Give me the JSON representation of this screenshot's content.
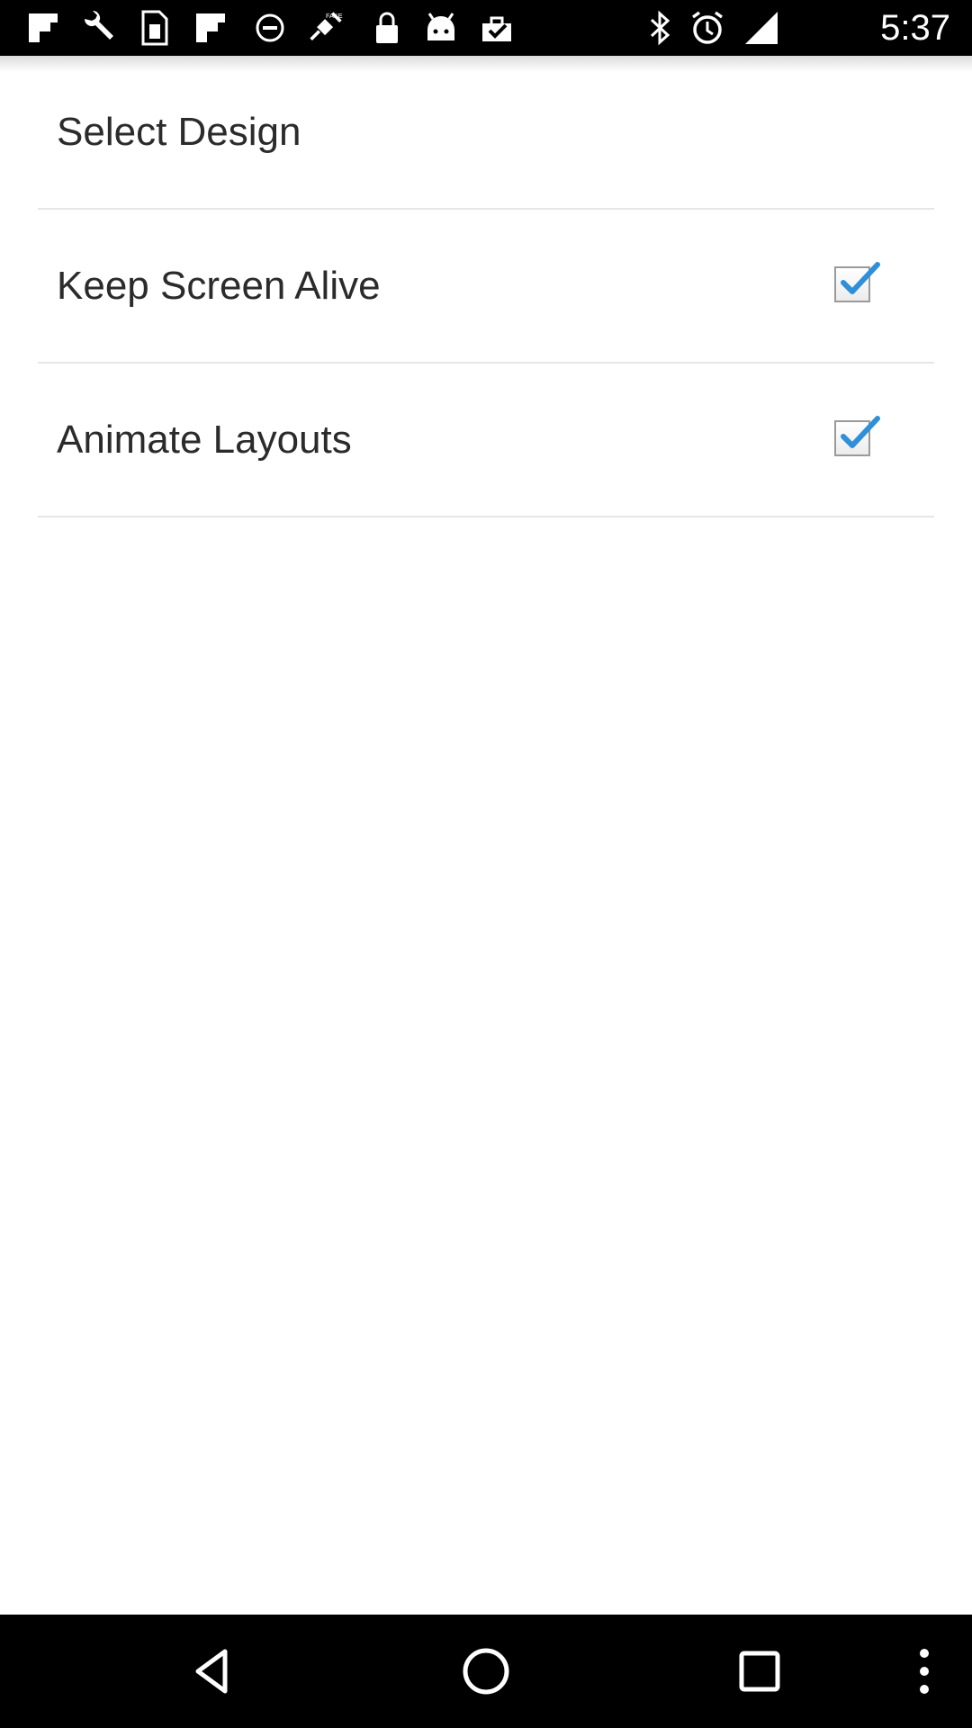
{
  "status_bar": {
    "time": "5:37",
    "left_icons": [
      "flipboard-icon",
      "wrench-icon",
      "sim-card-icon",
      "flipboard-icon",
      "blocked-icon",
      "fake-gps-icon",
      "lock-icon",
      "android-icon",
      "check-bag-icon"
    ],
    "right_icons": [
      "bluetooth-icon",
      "alarm-icon",
      "signal-icon"
    ]
  },
  "settings": {
    "items": [
      {
        "label": "Select Design",
        "has_checkbox": false
      },
      {
        "label": "Keep Screen Alive",
        "has_checkbox": true,
        "checked": true
      },
      {
        "label": "Animate Layouts",
        "has_checkbox": true,
        "checked": true
      }
    ]
  },
  "nav_bar": {
    "buttons": [
      "back-icon",
      "home-icon",
      "recents-icon",
      "overflow-menu-icon"
    ]
  },
  "colors": {
    "check_accent": "#2f8fd8",
    "status_bar_bg": "#000000",
    "nav_bar_bg": "#000000"
  }
}
